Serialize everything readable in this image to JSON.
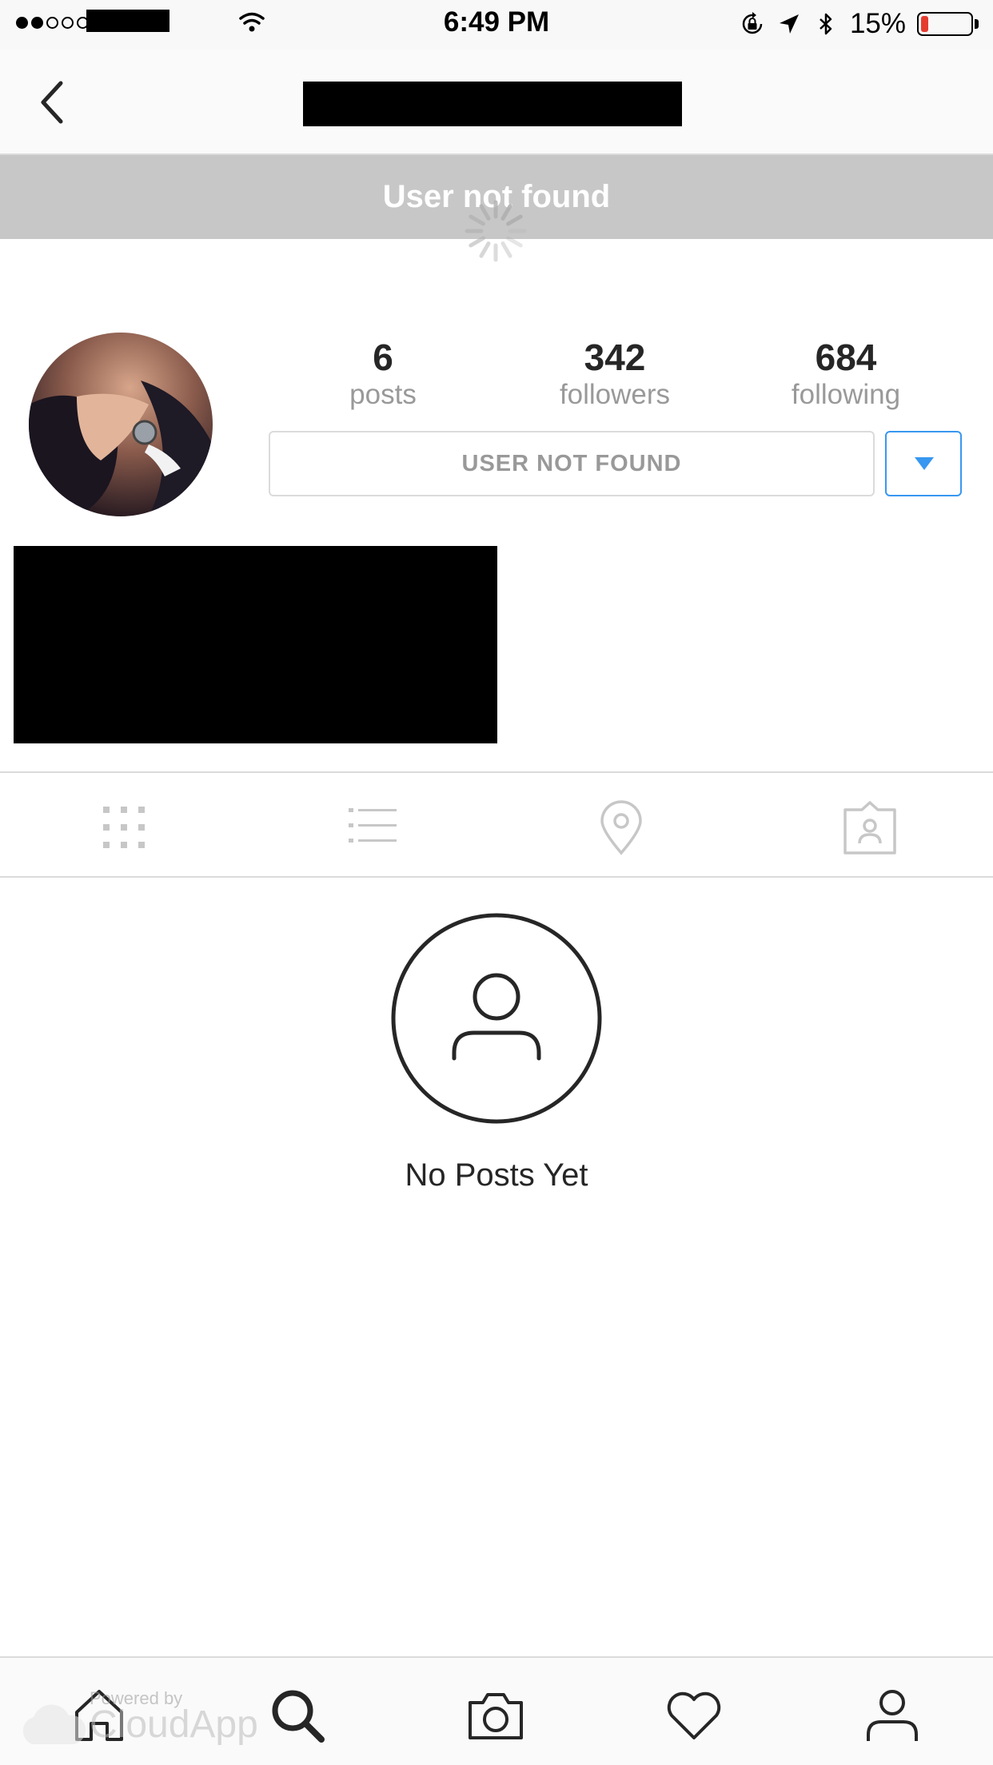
{
  "status_bar": {
    "time": "6:49 PM",
    "battery_text": "15%",
    "battery_level": 0.15,
    "signal_bars_filled": 2,
    "signal_bars_total": 5,
    "icons": [
      "wifi-icon",
      "orientation-lock-icon",
      "location-arrow-icon",
      "bluetooth-icon",
      "battery-icon"
    ]
  },
  "nav": {
    "back_icon": "chevron-left-icon"
  },
  "banner": {
    "text": "User not found"
  },
  "profile": {
    "stats": [
      {
        "value": "6",
        "label": "posts"
      },
      {
        "value": "342",
        "label": "followers"
      },
      {
        "value": "684",
        "label": "following"
      }
    ],
    "status_button_label": "USER NOT FOUND",
    "dropdown_icon": "caret-down-icon"
  },
  "tabs": [
    {
      "name": "grid",
      "icon": "grid-icon"
    },
    {
      "name": "list",
      "icon": "list-icon"
    },
    {
      "name": "location",
      "icon": "map-pin-icon"
    },
    {
      "name": "tagged",
      "icon": "tagged-photos-icon"
    }
  ],
  "empty_state": {
    "icon": "person-circle-icon",
    "text": "No Posts Yet"
  },
  "bottom_tabs": [
    {
      "name": "home",
      "icon": "home-icon"
    },
    {
      "name": "search",
      "icon": "search-icon"
    },
    {
      "name": "camera",
      "icon": "camera-icon"
    },
    {
      "name": "activity",
      "icon": "heart-icon"
    },
    {
      "name": "profile",
      "icon": "profile-icon"
    }
  ],
  "watermark": {
    "line1": "Powered by",
    "line2": "CloudApp"
  },
  "colors": {
    "accent": "#3897f0",
    "banner": "#c7c7c7",
    "battery_low": "#e43c2f"
  }
}
